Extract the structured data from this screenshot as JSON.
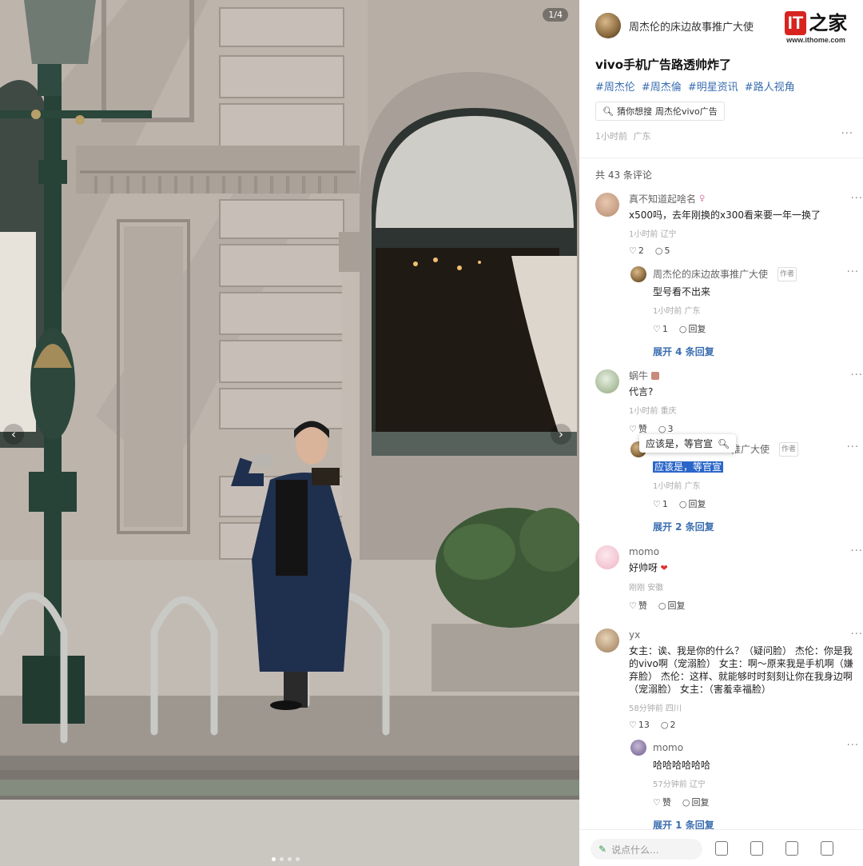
{
  "photo": {
    "counter": "1/4",
    "nav_left": "‹",
    "nav_right": "›",
    "dots": 4,
    "active_dot": 0
  },
  "logo": {
    "mark": "IT",
    "cn": "之家",
    "url": "www.ithome.com"
  },
  "post": {
    "author": "周杰伦的床边故事推广大使",
    "title": "vivo手机广告路透帅炸了",
    "tags": [
      "#周杰伦",
      "#周杰倫",
      "#明星资讯",
      "#路人视角"
    ],
    "guess_label": "猜你想搜",
    "guess_query": "周杰伦vivo广告",
    "time": "1小时前",
    "location": "广东",
    "more": "···"
  },
  "comments_count": "共 43 条评论",
  "comments": [
    {
      "user": "真不知道起啥名",
      "text": "x500吗，去年刚换的x300看来要一年一换了",
      "time": "1小时前",
      "location": "辽宁",
      "likes": "2",
      "replies": "5",
      "reply": {
        "user": "周杰伦的床边故事推广大使",
        "tag": "作者",
        "text": "型号看不出来",
        "time": "1小时前",
        "location": "广东",
        "likes": "1",
        "reply_label": "回复"
      },
      "expand": "展开 4 条回复"
    },
    {
      "user": "蜗牛",
      "text": "代言?",
      "time": "1小时前",
      "location": "重庆",
      "likes": "赞",
      "replies": "3",
      "reply": {
        "user": "推广大使",
        "tag": "作者",
        "text": "应该是，等官宣",
        "time": "1小时前",
        "location": "广东",
        "likes": "1",
        "reply_label": "回复"
      },
      "expand": "展开 2 条回复"
    },
    {
      "user": "momo",
      "text": "好帅呀",
      "time": "刚刚",
      "location": "安徽",
      "likes": "赞",
      "replies": "回复"
    },
    {
      "user": "yx",
      "text": "女主：诶、我是你的什么？（疑问脸） 杰伦：你是我的vivo啊（宠溺脸） 女主：啊～原来我是手机啊（嫌弃脸） 杰伦：这样、就能够时时刻刻让你在我身边啊（宠溺脸） 女主：（害羞幸福脸）",
      "time": "58分钟前",
      "location": "四川",
      "likes": "13",
      "replies": "2",
      "reply": {
        "user": "momo",
        "text": "哈哈哈哈哈哈",
        "time": "57分钟前",
        "location": "辽宁",
        "likes": "赞",
        "reply_label": "回复"
      },
      "expand": "展开 1 条回复"
    }
  ],
  "popup": "应该是，等官宣",
  "bottom": {
    "placeholder": "说点什么..."
  },
  "colors": {
    "link": "#3a6db0",
    "brand_red": "#d8231e",
    "selection": "#2a66c9"
  }
}
